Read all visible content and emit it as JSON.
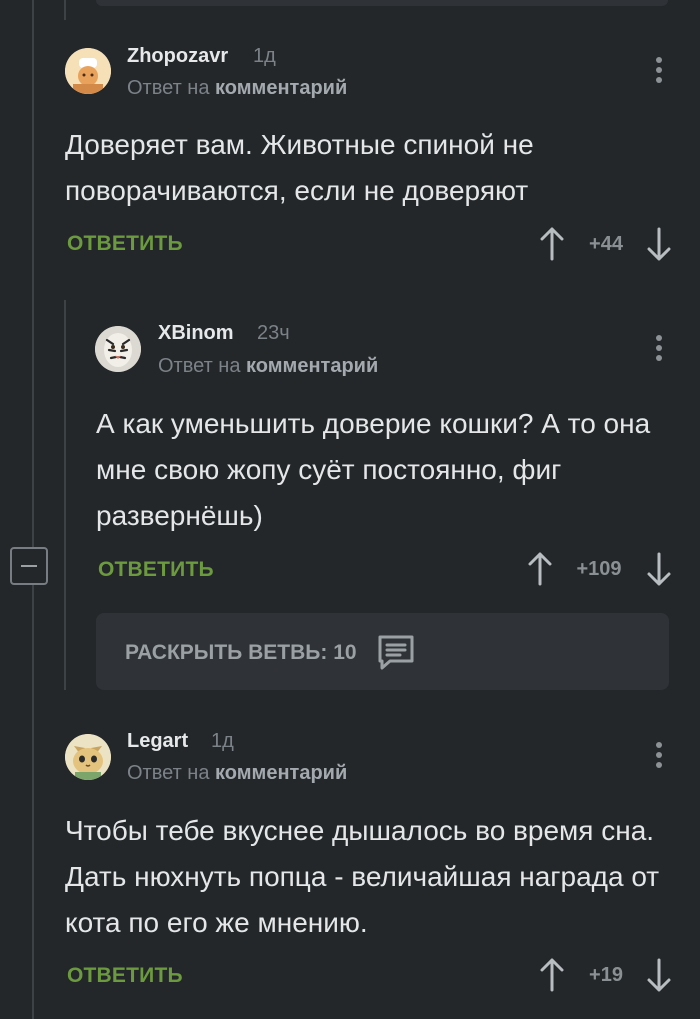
{
  "comments": [
    {
      "username": "Zhopozavr",
      "time": "1д",
      "reply_prefix": "Ответ на",
      "reply_target": "комментарий",
      "text": "Доверяет вам. Животные спиной не поворачиваются, если не доверяют",
      "reply_label": "ОТВЕТИТЬ",
      "score": "+44",
      "avatar_icon": "cook-avatar-icon"
    },
    {
      "username": "XBinom",
      "time": "23ч",
      "reply_prefix": "Ответ на",
      "reply_target": "комментарий",
      "text": "А как уменьшить доверие кошки? А то она мне свою жопу суёт постоянно, фиг развернёшь)",
      "reply_label": "ОТВЕТИТЬ",
      "score": "+109",
      "avatar_icon": "tiger-avatar-icon"
    },
    {
      "username": "Legart",
      "time": "1д",
      "reply_prefix": "Ответ на",
      "reply_target": "комментарий",
      "text": "Чтобы тебе вкуснее дышалось во время сна. Дать нюхнуть попца - величайшая награда от кота по его же мнению.",
      "reply_label": "ОТВЕТИТЬ",
      "score": "+19",
      "avatar_icon": "cat-avatar-icon"
    }
  ],
  "expand_branch": {
    "label": "РАСКРЫТЬ ВЕТВЬ: 10",
    "icon": "comments-icon"
  },
  "colors": {
    "background": "#23272a",
    "card": "#2f3337",
    "reply_green": "#6c9a3f",
    "muted": "#7b8288"
  }
}
